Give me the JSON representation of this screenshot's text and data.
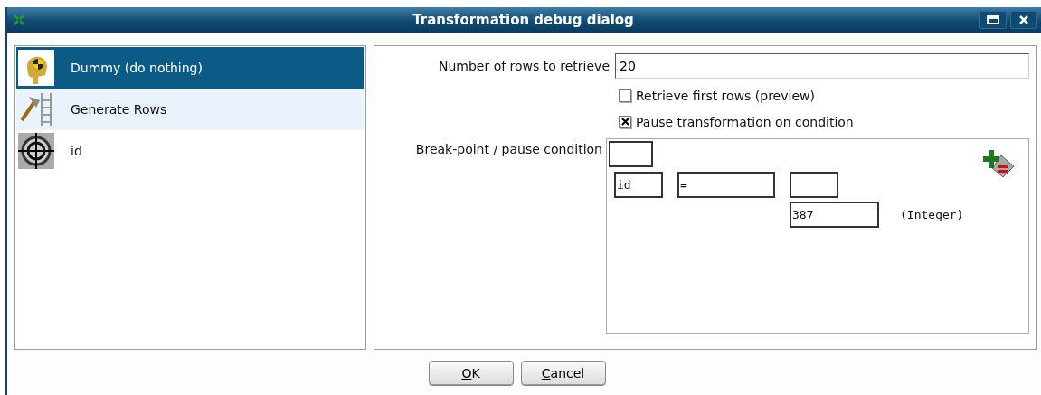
{
  "window": {
    "title": "Transformation debug dialog"
  },
  "steps": [
    {
      "label": "Dummy (do nothing)",
      "selected": true
    },
    {
      "label": "Generate Rows",
      "selected": false,
      "hovered": true
    },
    {
      "label": "id",
      "selected": false,
      "hovered": false
    }
  ],
  "rows_to_retrieve": {
    "label": "Number of rows to retrieve",
    "value": "20"
  },
  "options": [
    {
      "label": "Retrieve first rows (preview)",
      "checked": false
    },
    {
      "label": "Pause transformation on condition",
      "checked": true
    }
  ],
  "condition": {
    "label": "Break-point / pause condition",
    "field": "id",
    "operator": "=",
    "value": "387",
    "type": "(Integer)"
  },
  "buttons": [
    {
      "label": "OK"
    },
    {
      "label": "Cancel"
    }
  ]
}
